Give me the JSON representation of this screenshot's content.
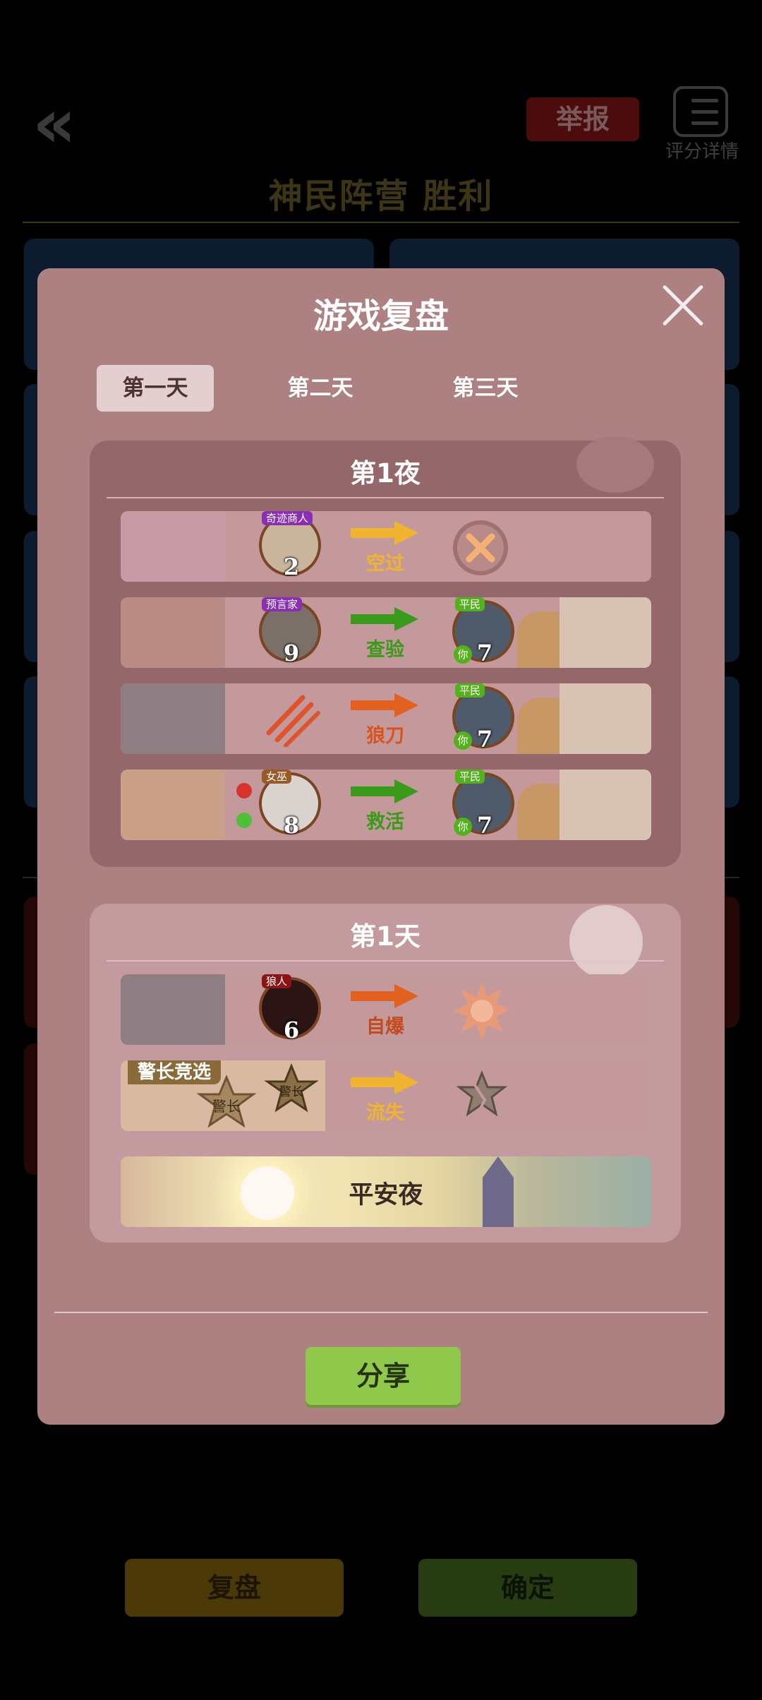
{
  "background": {
    "report_label": "举报",
    "detail_label": "评分详情",
    "result_title": "神民阵营  胜利",
    "review_button": "复盘",
    "confirm_button": "确定"
  },
  "modal": {
    "title": "游戏复盘",
    "tabs": [
      {
        "label": "第一天",
        "active": true
      },
      {
        "label": "第二天",
        "active": false
      },
      {
        "label": "第三天",
        "active": false
      }
    ],
    "night": {
      "title": "第1夜",
      "rows": [
        {
          "actor_role": "奇迹商人",
          "actor_number": "2",
          "action": "空过",
          "action_color": "#f0b431"
        },
        {
          "actor_role": "预言家",
          "actor_number": "9",
          "action": "查验",
          "action_color": "#3a9a1a",
          "target_role": "平民",
          "target_number": "7",
          "target_you": "你"
        },
        {
          "action": "狼刀",
          "action_color": "#d9541d",
          "target_role": "平民",
          "target_number": "7",
          "target_you": "你"
        },
        {
          "actor_role": "女巫",
          "actor_number": "8",
          "action": "救活",
          "action_color": "#3a9a1a",
          "target_role": "平民",
          "target_number": "7",
          "target_you": "你"
        }
      ]
    },
    "day": {
      "title": "第1天",
      "rows": [
        {
          "actor_role": "狼人",
          "actor_number": "6",
          "action": "自爆",
          "action_color": "#d9541d"
        },
        {
          "label": "警长竞选",
          "badge_text_1": "警长",
          "badge_text_2": "警长",
          "action": "流失",
          "action_color": "#f0b431"
        }
      ],
      "peace_label": "平安夜"
    },
    "share_button": "分享"
  }
}
